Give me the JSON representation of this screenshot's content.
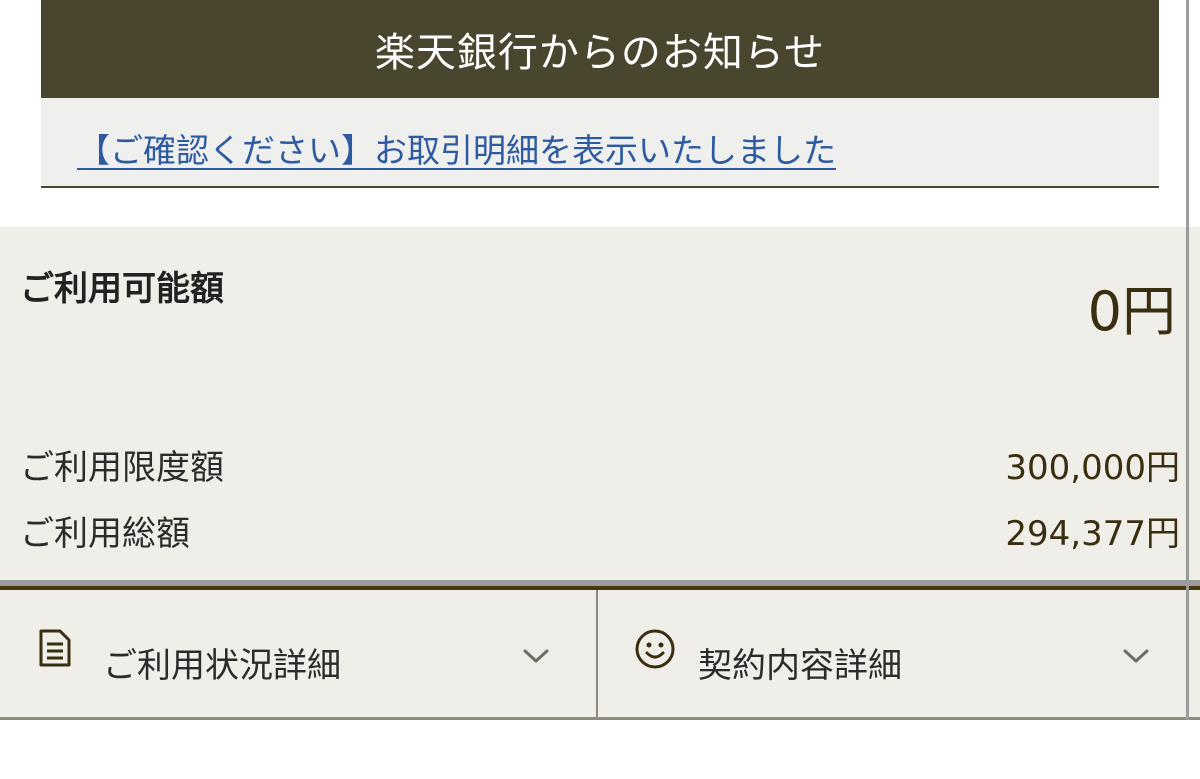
{
  "notice": {
    "title": "楽天銀行からのお知らせ",
    "link_text": "【ご確認ください】お取引明細を表示いたしました"
  },
  "credit": {
    "available_label": "ご利用可能額",
    "available_value": "0円",
    "limit_label": "ご利用限度額",
    "limit_value": "300,000円",
    "total_label": "ご利用総額",
    "total_value": "294,377円"
  },
  "buttons": [
    {
      "label": "ご利用状況詳細",
      "icon": "document-icon"
    },
    {
      "label": "契約内容詳細",
      "icon": "smiley-icon"
    }
  ],
  "colors": {
    "header_bg": "#4a452f",
    "link": "#2d5aa0",
    "panel_bg": "#efeee9",
    "value_text": "#3a2e10"
  }
}
